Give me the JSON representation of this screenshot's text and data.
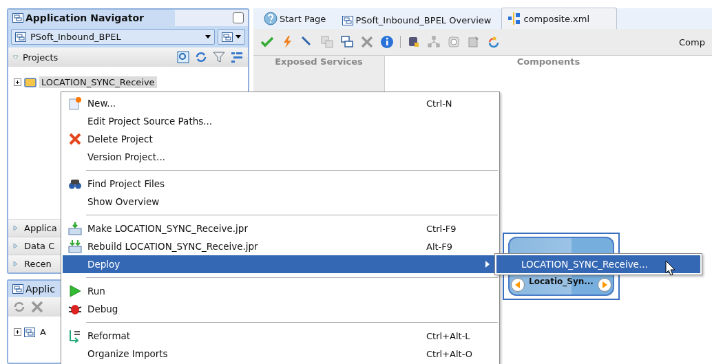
{
  "navigator": {
    "title": "Application Navigator",
    "application": "PSoft_Inbound_BPEL",
    "projects_header": {
      "label": "Projects",
      "expanded": true
    },
    "tree": [
      {
        "label": "LOCATION_SYNC_Receive",
        "expanded": false,
        "selected": true
      }
    ],
    "sections": [
      {
        "label": "Applica",
        "expanded": false
      },
      {
        "label": "Data C",
        "expanded": false
      },
      {
        "label": "Recen",
        "expanded": false
      }
    ]
  },
  "lower_panel": {
    "title": "Applic",
    "tree": [
      {
        "label": "A",
        "expanded": false
      }
    ]
  },
  "editor_tabs": [
    {
      "label": "Start Page",
      "selected": false
    },
    {
      "label": "PSoft_Inbound_BPEL Overview",
      "selected": false
    },
    {
      "label": "composite.xml",
      "selected": true
    }
  ],
  "toolbar": {
    "right_label": "Comp"
  },
  "canvas": {
    "columns": [
      "Exposed Services",
      "Components"
    ],
    "component": {
      "label": "Locatio_Syn...",
      "selected": true
    }
  },
  "context_menu": [
    {
      "kind": "item",
      "label": "New...",
      "shortcut": "Ctrl-N"
    },
    {
      "kind": "item",
      "label": "Edit Project Source Paths..."
    },
    {
      "kind": "item",
      "label": "Delete Project"
    },
    {
      "kind": "item",
      "label": "Version Project..."
    },
    {
      "kind": "separator"
    },
    {
      "kind": "item",
      "label": "Find Project Files"
    },
    {
      "kind": "item",
      "label": "Show Overview"
    },
    {
      "kind": "separator"
    },
    {
      "kind": "item",
      "label": "Make LOCATION_SYNC_Receive.jpr",
      "shortcut": "Ctrl-F9"
    },
    {
      "kind": "item",
      "label": "Rebuild LOCATION_SYNC_Receive.jpr",
      "shortcut": "Alt-F9"
    },
    {
      "kind": "submenu",
      "label": "Deploy",
      "selected": true
    },
    {
      "kind": "separator"
    },
    {
      "kind": "item",
      "label": "Run"
    },
    {
      "kind": "item",
      "label": "Debug"
    },
    {
      "kind": "separator"
    },
    {
      "kind": "item",
      "label": "Reformat",
      "shortcut": "Ctrl+Alt-L"
    },
    {
      "kind": "item",
      "label": "Organize Imports",
      "shortcut": "Ctrl+Alt-O"
    }
  ],
  "submenu": [
    {
      "label": "LOCATION_SYNC_Receive...",
      "selected": true
    }
  ]
}
